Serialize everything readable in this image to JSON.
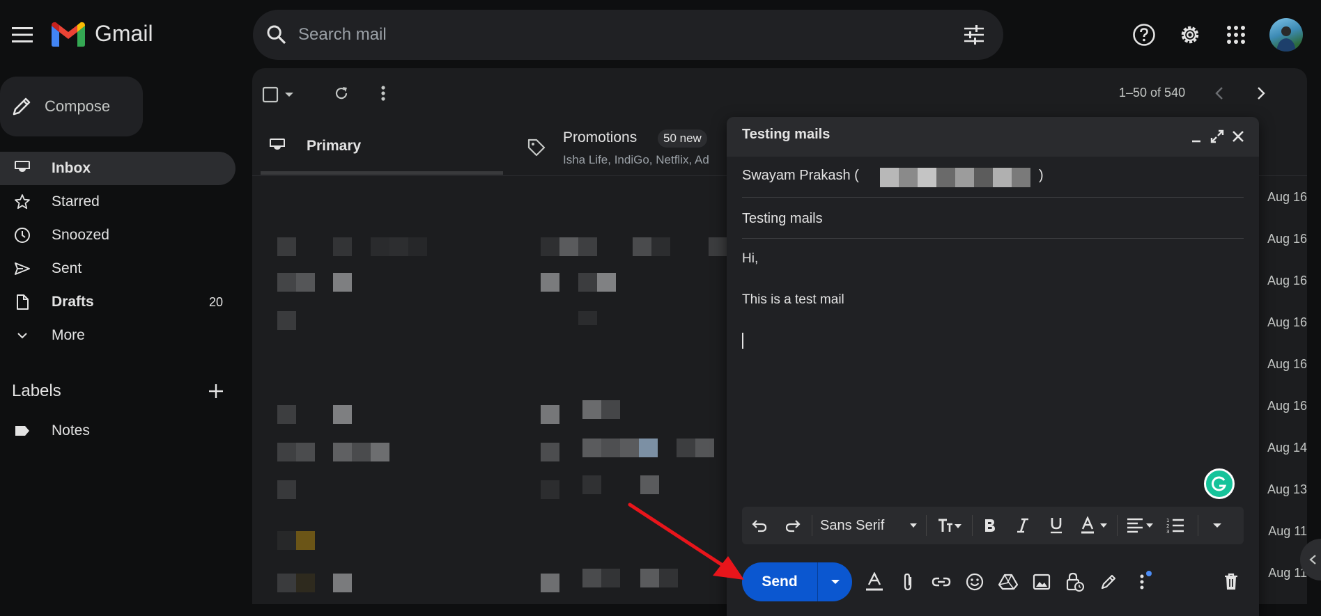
{
  "app": {
    "name": "Gmail"
  },
  "search": {
    "placeholder": "Search mail"
  },
  "compose_button": {
    "label": "Compose"
  },
  "sidebar": {
    "items": [
      {
        "label": "Inbox",
        "count": ""
      },
      {
        "label": "Starred",
        "count": ""
      },
      {
        "label": "Snoozed",
        "count": ""
      },
      {
        "label": "Sent",
        "count": ""
      },
      {
        "label": "Drafts",
        "count": "20"
      },
      {
        "label": "More",
        "count": ""
      }
    ],
    "labels_heading": "Labels",
    "labels": [
      {
        "label": "Notes"
      }
    ]
  },
  "toolbar": {
    "pagination": "1–50 of 540"
  },
  "tabs": {
    "primary": {
      "label": "Primary"
    },
    "promotions": {
      "label": "Promotions",
      "badge": "50 new",
      "snippet": "Isha Life, IndiGo, Netflix, Ad"
    }
  },
  "list": {
    "dates": [
      "Aug 16",
      "Aug 16",
      "Aug 16",
      "Aug 16",
      "Aug 16",
      "Aug 16",
      "Aug 14",
      "Aug 13",
      "Aug 11",
      "Aug 11"
    ]
  },
  "compose_window": {
    "title": "Testing mails",
    "to_name": "Swayam Prakash (",
    "to_close": ")",
    "subject": "Testing mails",
    "body_line1": "Hi,",
    "body_line2": "This is a test mail",
    "font_name": "Sans Serif",
    "send_label": "Send"
  },
  "colors": {
    "send_button": "#0b57d0",
    "annotation_arrow": "#e8151b",
    "grammarly": "#15c39a"
  }
}
